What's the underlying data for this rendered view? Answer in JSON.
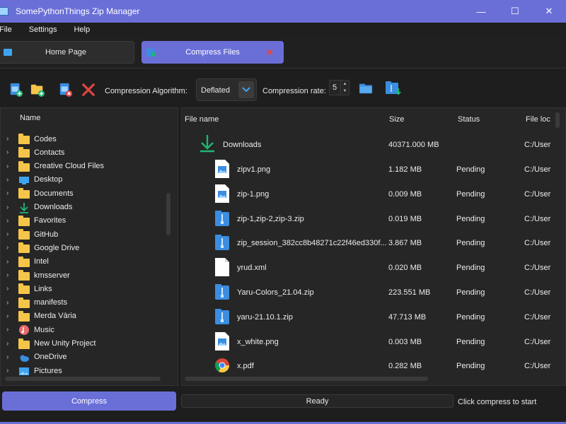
{
  "window": {
    "title": "SomePythonThings Zip Manager",
    "minimize": "—",
    "maximize": "☐",
    "close": "✕"
  },
  "menu": [
    "File",
    "Settings",
    "Help"
  ],
  "tabs": {
    "home": "Home Page",
    "compress": "Compress Files"
  },
  "toolbar": {
    "algorithm_label": "Compression Algorithm:",
    "algorithm_value": "Deflated",
    "rate_label": "Compression rate:",
    "rate_value": "5"
  },
  "tree": {
    "header": "Name",
    "items": [
      {
        "label": "Codes",
        "icon": "folder-icon"
      },
      {
        "label": "Contacts",
        "icon": "folder-icon"
      },
      {
        "label": "Creative Cloud Files",
        "icon": "folder-icon"
      },
      {
        "label": "Desktop",
        "icon": "desktop-icon"
      },
      {
        "label": "Documents",
        "icon": "folder-icon"
      },
      {
        "label": "Downloads",
        "icon": "download-icon"
      },
      {
        "label": "Favorites",
        "icon": "folder-icon"
      },
      {
        "label": "GitHub",
        "icon": "folder-icon"
      },
      {
        "label": "Google Drive",
        "icon": "folder-icon"
      },
      {
        "label": "Intel",
        "icon": "folder-icon"
      },
      {
        "label": "kmsserver",
        "icon": "folder-icon"
      },
      {
        "label": "Links",
        "icon": "folder-icon"
      },
      {
        "label": "manifests",
        "icon": "folder-icon"
      },
      {
        "label": "Merda Vària",
        "icon": "folder-icon"
      },
      {
        "label": "Music",
        "icon": "music-icon"
      },
      {
        "label": "New Unity Project",
        "icon": "folder-icon"
      },
      {
        "label": "OneDrive",
        "icon": "cloud-icon"
      },
      {
        "label": "Pictures",
        "icon": "pictures-icon"
      }
    ]
  },
  "files": {
    "headers": {
      "name": "File name",
      "size": "Size",
      "status": "Status",
      "location": "File loc"
    },
    "root": {
      "name": "Downloads",
      "size": "40371.000 MB",
      "location": "C:/User"
    },
    "rows": [
      {
        "name": "zipv1.png",
        "size": "1.182 MB",
        "status": "Pending",
        "location": "C:/User",
        "icon": "image-file-icon"
      },
      {
        "name": "zip-1.png",
        "size": "0.009 MB",
        "status": "Pending",
        "location": "C:/User",
        "icon": "image-file-icon"
      },
      {
        "name": "zip-1,zip-2,zip-3.zip",
        "size": "0.019 MB",
        "status": "Pending",
        "location": "C:/User",
        "icon": "zip-file-icon"
      },
      {
        "name": "zip_session_382cc8b48271c22f46ed330f...",
        "size": "3.867 MB",
        "status": "Pending",
        "location": "C:/User",
        "icon": "zip-file-icon"
      },
      {
        "name": "yrud.xml",
        "size": "0.020 MB",
        "status": "Pending",
        "location": "C:/User",
        "icon": "blank-file-icon"
      },
      {
        "name": "Yaru-Colors_21.04.zip",
        "size": "223.551 MB",
        "status": "Pending",
        "location": "C:/User",
        "icon": "zip-file-icon"
      },
      {
        "name": "yaru-21.10.1.zip",
        "size": "47.713 MB",
        "status": "Pending",
        "location": "C:/User",
        "icon": "zip-file-icon"
      },
      {
        "name": "x_white.png",
        "size": "0.003 MB",
        "status": "Pending",
        "location": "C:/User",
        "icon": "image-file-icon"
      },
      {
        "name": "x.pdf",
        "size": "0.282 MB",
        "status": "Pending",
        "location": "C:/User",
        "icon": "chrome-icon"
      }
    ]
  },
  "bottom": {
    "compress": "Compress",
    "progress": "Ready",
    "status": "Click compress to start"
  },
  "colors": {
    "accent": "#6a6fd8",
    "folder": "#f5c54a",
    "file_blue": "#3b8de0",
    "close_red": "#e04545",
    "download_green": "#22b573"
  }
}
